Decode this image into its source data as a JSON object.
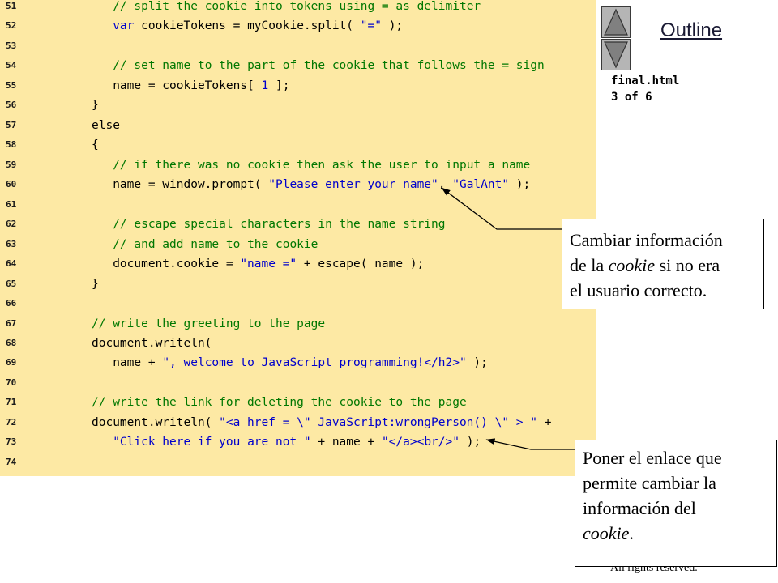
{
  "outline": {
    "link_label": "Outline",
    "file_name": "final.html",
    "page_indicator": "3 of 6"
  },
  "nav": {
    "up_icon": "triangle-up-icon",
    "down_icon": "triangle-down-icon"
  },
  "colors": {
    "code_background": "#fde9a4",
    "comment": "#007700",
    "string": "#0000cc",
    "keyword": "#0000cc",
    "number": "#0000cc",
    "plain": "#000000"
  },
  "code": {
    "lines": [
      {
        "number": "51",
        "tokens": [
          {
            "k": "plain",
            "t": "   "
          },
          {
            "k": "comment",
            "t": "// split the cookie into tokens using = as delimiter"
          }
        ]
      },
      {
        "number": "52",
        "tokens": [
          {
            "k": "plain",
            "t": "   "
          },
          {
            "k": "keyword",
            "t": "var"
          },
          {
            "k": "plain",
            "t": " cookieTokens = myCookie.split( "
          },
          {
            "k": "string",
            "t": "\"=\""
          },
          {
            "k": "plain",
            "t": " );"
          }
        ]
      },
      {
        "number": "53",
        "tokens": []
      },
      {
        "number": "54",
        "tokens": [
          {
            "k": "plain",
            "t": "   "
          },
          {
            "k": "comment",
            "t": "// set name to the part of the cookie that follows the = sign"
          }
        ]
      },
      {
        "number": "55",
        "tokens": [
          {
            "k": "plain",
            "t": "   name = cookieTokens[ "
          },
          {
            "k": "number",
            "t": "1"
          },
          {
            "k": "plain",
            "t": " ];"
          }
        ]
      },
      {
        "number": "56",
        "tokens": [
          {
            "k": "plain",
            "t": "}"
          }
        ]
      },
      {
        "number": "57",
        "tokens": [
          {
            "k": "plain",
            "t": "else"
          }
        ]
      },
      {
        "number": "58",
        "tokens": [
          {
            "k": "plain",
            "t": "{"
          }
        ]
      },
      {
        "number": "59",
        "tokens": [
          {
            "k": "plain",
            "t": "   "
          },
          {
            "k": "comment",
            "t": "// if there was no cookie then ask the user to input a name"
          }
        ]
      },
      {
        "number": "60",
        "tokens": [
          {
            "k": "plain",
            "t": "   name = window.prompt( "
          },
          {
            "k": "string",
            "t": "\"Please enter your name\""
          },
          {
            "k": "plain",
            "t": ", "
          },
          {
            "k": "string",
            "t": "\"GalAnt\""
          },
          {
            "k": "plain",
            "t": " );"
          }
        ]
      },
      {
        "number": "61",
        "tokens": []
      },
      {
        "number": "62",
        "tokens": [
          {
            "k": "plain",
            "t": "   "
          },
          {
            "k": "comment",
            "t": "// escape special characters in the name string"
          }
        ]
      },
      {
        "number": "63",
        "tokens": [
          {
            "k": "plain",
            "t": "   "
          },
          {
            "k": "comment",
            "t": "// and add name to the cookie"
          }
        ]
      },
      {
        "number": "64",
        "tokens": [
          {
            "k": "plain",
            "t": "   document.cookie = "
          },
          {
            "k": "string",
            "t": "\"name =\""
          },
          {
            "k": "plain",
            "t": " + escape( name );"
          }
        ]
      },
      {
        "number": "65",
        "tokens": [
          {
            "k": "plain",
            "t": "}"
          }
        ]
      },
      {
        "number": "66",
        "tokens": []
      },
      {
        "number": "67",
        "tokens": [
          {
            "k": "comment",
            "t": "// write the greeting to the page"
          }
        ]
      },
      {
        "number": "68",
        "tokens": [
          {
            "k": "plain",
            "t": "document.writeln("
          }
        ]
      },
      {
        "number": "69",
        "tokens": [
          {
            "k": "plain",
            "t": "   name + "
          },
          {
            "k": "string",
            "t": "\", welcome to JavaScript programming!</h2>\""
          },
          {
            "k": "plain",
            "t": " );"
          }
        ]
      },
      {
        "number": "70",
        "tokens": []
      },
      {
        "number": "71",
        "tokens": [
          {
            "k": "comment",
            "t": "// write the link for deleting the cookie to the page"
          }
        ]
      },
      {
        "number": "72",
        "tokens": [
          {
            "k": "plain",
            "t": "document.writeln( "
          },
          {
            "k": "string",
            "t": "\"<a href = \\\" JavaScript:wrongPerson() \\\" > \""
          },
          {
            "k": "plain",
            "t": " +"
          }
        ]
      },
      {
        "number": "73",
        "tokens": [
          {
            "k": "plain",
            "t": "   "
          },
          {
            "k": "string",
            "t": "\"Click here if you are not \""
          },
          {
            "k": "plain",
            "t": " + name + "
          },
          {
            "k": "string",
            "t": "\"</a><br/>\""
          },
          {
            "k": "plain",
            "t": " );"
          }
        ]
      },
      {
        "number": "74",
        "tokens": []
      }
    ]
  },
  "callouts": [
    {
      "lines": [
        [
          {
            "text": "Cambiar información"
          }
        ],
        [
          {
            "text": "de la "
          },
          {
            "text": "cookie",
            "italic": true
          },
          {
            "text": " si no era"
          }
        ],
        [
          {
            "text": "el usuario correcto."
          }
        ]
      ]
    },
    {
      "lines": [
        [
          {
            "text": "Poner el enlace que"
          }
        ],
        [
          {
            "text": "permite cambiar la"
          }
        ],
        [
          {
            "text": "información del"
          }
        ],
        [
          {
            "text": "cookie",
            "italic": true
          },
          {
            "text": "."
          }
        ]
      ]
    }
  ],
  "footer": {
    "copyright_fragment": "All rights reserved."
  }
}
